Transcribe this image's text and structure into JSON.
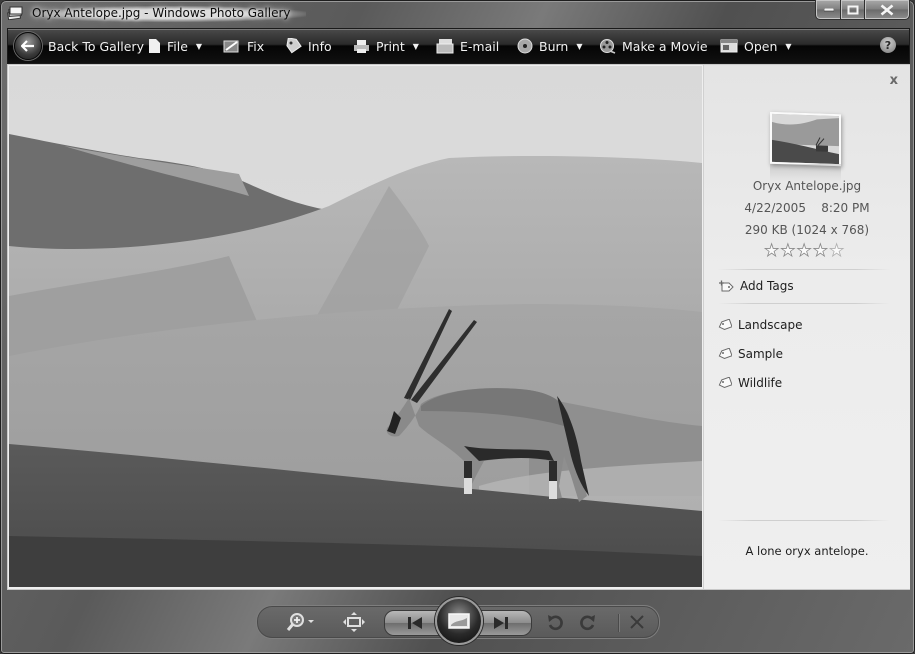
{
  "window": {
    "title": "Oryx Antelope.jpg - Windows Photo Gallery",
    "controls": [
      "minimize",
      "maximize",
      "close"
    ]
  },
  "toolbar": {
    "back_label": "Back To Gallery",
    "items": [
      {
        "label": "File",
        "icon": "file-icon",
        "has_menu": true
      },
      {
        "label": "Fix",
        "icon": "fix-icon",
        "has_menu": false
      },
      {
        "label": "Info",
        "icon": "tag-icon",
        "has_menu": false
      },
      {
        "label": "Print",
        "icon": "printer-icon",
        "has_menu": true
      },
      {
        "label": "E-mail",
        "icon": "email-icon",
        "has_menu": false
      },
      {
        "label": "Burn",
        "icon": "disc-icon",
        "has_menu": true
      },
      {
        "label": "Make a Movie",
        "icon": "film-reel-icon",
        "has_menu": false
      },
      {
        "label": "Open",
        "icon": "open-window-icon",
        "has_menu": true
      }
    ],
    "help_label": "?"
  },
  "photo": {
    "subject": "Oryx antelope standing on a desert dune"
  },
  "info_pane": {
    "close_label": "x",
    "filename": "Oryx Antelope.jpg",
    "date": "4/22/2005",
    "time": "8:20 PM",
    "size": "290 KB (1024 x 768)",
    "rating": 0,
    "rating_max": 5,
    "add_tags_label": "Add Tags",
    "tags": [
      "Landscape",
      "Sample",
      "Wildlife"
    ],
    "caption": "A lone oryx antelope."
  },
  "controls": {
    "zoom": "zoom-icon",
    "fit": "actual-size-icon",
    "previous": "previous-icon",
    "slideshow": "slideshow-icon",
    "next": "next-icon",
    "rotate_ccw": "rotate-counterclockwise-icon",
    "rotate_cw": "rotate-clockwise-icon",
    "delete": "delete-icon"
  }
}
